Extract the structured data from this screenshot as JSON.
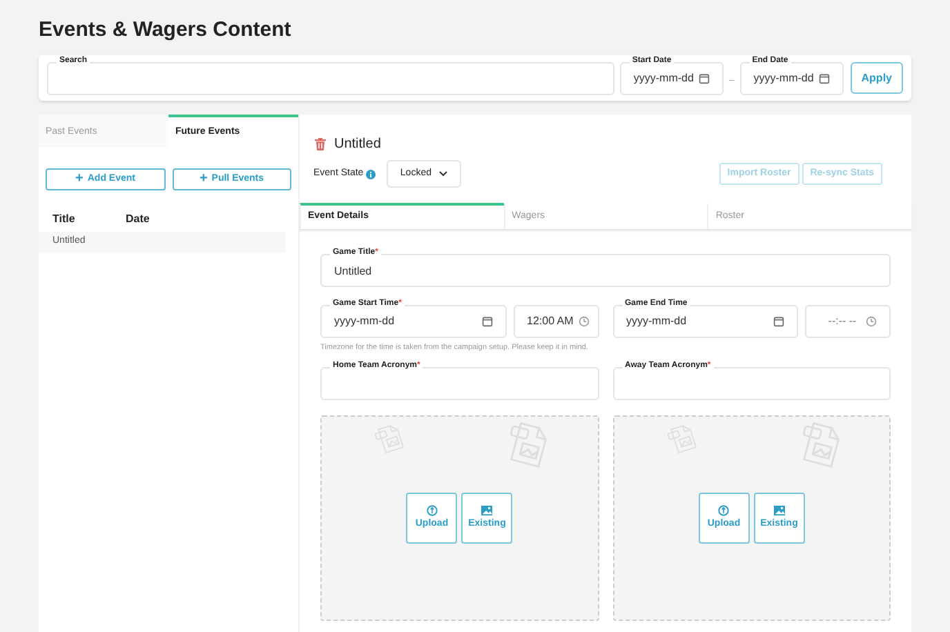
{
  "page_title": "Events & Wagers Content",
  "filters": {
    "search": {
      "label": "Search"
    },
    "start_date": {
      "label": "Start Date",
      "placeholder": "yyyy-mm-dd"
    },
    "separator": "–",
    "end_date": {
      "label": "End Date",
      "placeholder": "yyyy-mm-dd"
    },
    "apply": "Apply"
  },
  "list_tabs": [
    {
      "label": "Past Events",
      "selected": false
    },
    {
      "label": "Future Events",
      "selected": true
    }
  ],
  "list_buttons": [
    {
      "icon": "+",
      "label": "Add Event"
    },
    {
      "icon": "+",
      "label": "Pull Events"
    }
  ],
  "event_table": {
    "columns": [
      "Title",
      "Date"
    ],
    "rows": [
      {
        "cells": [
          "Untitled"
        ]
      }
    ]
  },
  "event": {
    "title": "Untitled",
    "state_label": "Event State",
    "state_value": "Locked",
    "actions": [
      {
        "label": "Import Roster",
        "disabled": true
      },
      {
        "label": "Re-sync Stats",
        "disabled": true
      }
    ]
  },
  "detail_tabs": [
    {
      "label": "Event Details",
      "selected": true
    },
    {
      "label": "Wagers",
      "selected": false
    },
    {
      "label": "Roster",
      "selected": false
    }
  ],
  "form": {
    "game_title": {
      "label": "Game Title",
      "required_mark": "*",
      "value": "Untitled"
    },
    "game_start_time": {
      "label": "Game Start Time",
      "required_mark": "*",
      "date_placeholder": "yyyy-mm-dd",
      "time_value": "12:00 AM"
    },
    "game_end_time": {
      "label": "Game End Time",
      "date_placeholder": "yyyy-mm-dd",
      "time_placeholder": "--:-- --"
    },
    "timezone_hint": "Timezone for the time is taken from the campaign setup. Please keep it in mind.",
    "home_team_acronym": {
      "label": "Home Team Acronym",
      "required_mark": "*"
    },
    "away_team_acronym": {
      "label": "Away Team Acronym",
      "required_mark": "*"
    },
    "image_slots": [
      {
        "buttons": [
          {
            "kind": "upload",
            "label": "Upload"
          },
          {
            "kind": "existing",
            "label": "Existing"
          }
        ]
      },
      {
        "buttons": [
          {
            "kind": "upload",
            "label": "Upload"
          },
          {
            "kind": "existing",
            "label": "Existing"
          }
        ]
      }
    ]
  }
}
